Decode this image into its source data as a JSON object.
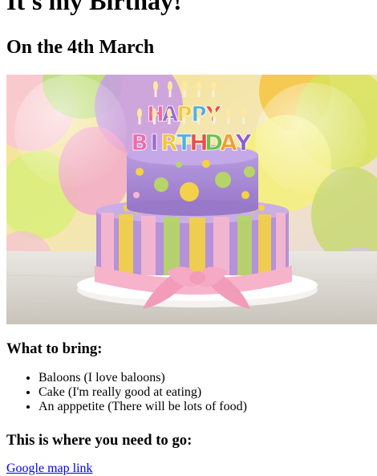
{
  "page": {
    "title": "It's my Birthay!",
    "date_heading": "On the 4th March",
    "hero_image": {
      "candle_letters_top": [
        "H",
        "A",
        "P",
        "P",
        "Y"
      ],
      "candle_letters_bottom": [
        "B",
        "I",
        "R",
        "T",
        "H",
        "D",
        "A",
        "Y"
      ]
    },
    "bring_heading": "What to bring:",
    "bring_items": [
      "Baloons (I love baloons)",
      "Cake (I'm really good at eating)",
      "An apppetite (There will be lots of food)"
    ],
    "location_heading": "This is where you need to go:",
    "map_link_label": "Google map link"
  },
  "colors": {
    "link": "#0000ee",
    "cake_purple": "#a98bd6",
    "cake_yellow": "#f3d14a",
    "cake_green": "#b7d46a",
    "cake_pink": "#f6b7cf"
  }
}
